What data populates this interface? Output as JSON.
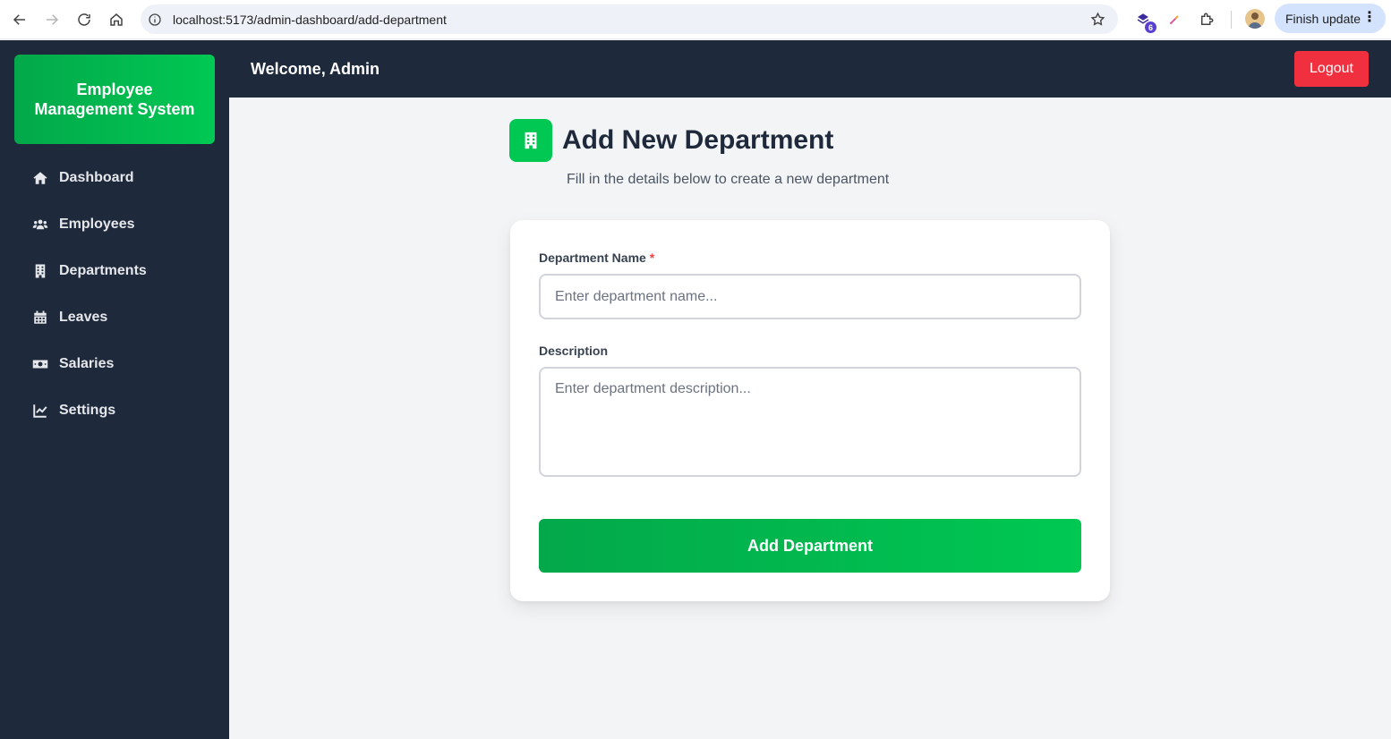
{
  "browser": {
    "url": "localhost:5173/admin-dashboard/add-department",
    "extension_badge": "6",
    "finish_update_label": "Finish update"
  },
  "sidebar": {
    "brand": "Employee Management System",
    "items": [
      {
        "label": "Dashboard",
        "icon": "home-icon"
      },
      {
        "label": "Employees",
        "icon": "users-icon"
      },
      {
        "label": "Departments",
        "icon": "building-icon"
      },
      {
        "label": "Leaves",
        "icon": "calendar-icon"
      },
      {
        "label": "Salaries",
        "icon": "money-icon"
      },
      {
        "label": "Settings",
        "icon": "chart-line-icon"
      }
    ]
  },
  "header": {
    "welcome": "Welcome, Admin",
    "logout_label": "Logout"
  },
  "page": {
    "title": "Add New Department",
    "subtitle": "Fill in the details below to create a new department"
  },
  "form": {
    "name_label": "Department Name",
    "required_marker": "*",
    "name_placeholder": "Enter department name...",
    "name_value": "",
    "description_label": "Description",
    "description_placeholder": "Enter department description...",
    "description_value": "",
    "submit_label": "Add Department"
  },
  "colors": {
    "sidebar_bg": "#1e293b",
    "accent_green": "#00c853",
    "logout_red": "#f0303f"
  }
}
